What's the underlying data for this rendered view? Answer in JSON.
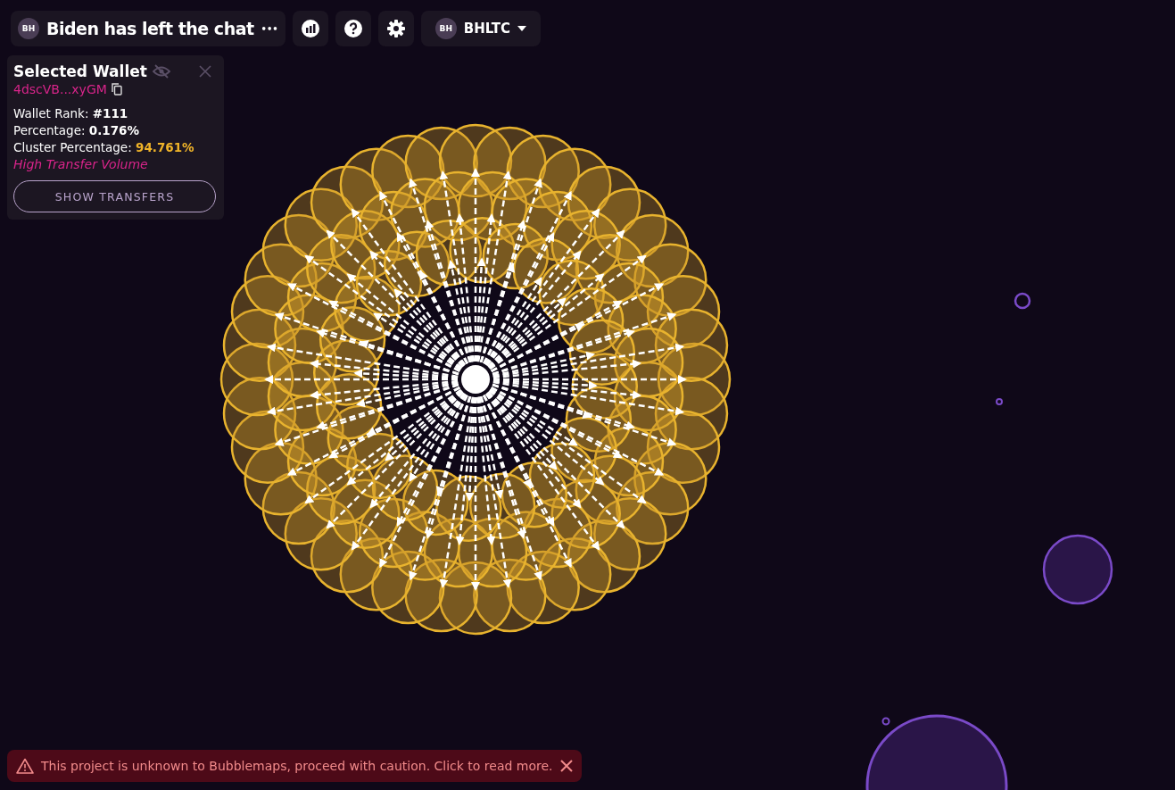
{
  "header": {
    "token_badge": "BH",
    "token_name": "Biden has left the chat",
    "more": "•••",
    "chain_badge": "BH",
    "chain_label": "BHLTC"
  },
  "selected_wallet": {
    "title": "Selected Wallet",
    "address": "4dscVB...xyGM",
    "rank_label": "Wallet Rank:",
    "rank": "#111",
    "percentage_label": "Percentage:",
    "percentage": "0.176%",
    "cluster_label": "Cluster Percentage:",
    "cluster": "94.761%",
    "tag": "High Transfer Volume",
    "button": "SHOW TRANSFERS"
  },
  "warning": {
    "text": "This project is unknown to Bubblemaps, proceed with caution. Click to read more."
  }
}
